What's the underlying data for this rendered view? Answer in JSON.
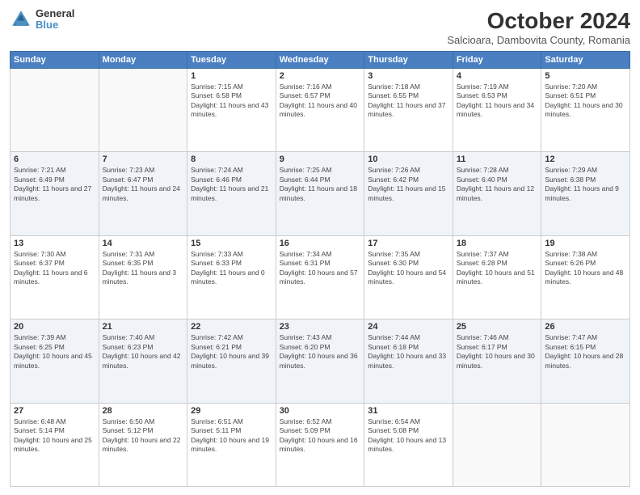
{
  "header": {
    "logo_general": "General",
    "logo_blue": "Blue",
    "main_title": "October 2024",
    "sub_title": "Salcioara, Dambovita County, Romania"
  },
  "days_of_week": [
    "Sunday",
    "Monday",
    "Tuesday",
    "Wednesday",
    "Thursday",
    "Friday",
    "Saturday"
  ],
  "weeks": [
    [
      {
        "day": "",
        "info": ""
      },
      {
        "day": "",
        "info": ""
      },
      {
        "day": "1",
        "info": "Sunrise: 7:15 AM\nSunset: 6:58 PM\nDaylight: 11 hours and 43 minutes."
      },
      {
        "day": "2",
        "info": "Sunrise: 7:16 AM\nSunset: 6:57 PM\nDaylight: 11 hours and 40 minutes."
      },
      {
        "day": "3",
        "info": "Sunrise: 7:18 AM\nSunset: 6:55 PM\nDaylight: 11 hours and 37 minutes."
      },
      {
        "day": "4",
        "info": "Sunrise: 7:19 AM\nSunset: 6:53 PM\nDaylight: 11 hours and 34 minutes."
      },
      {
        "day": "5",
        "info": "Sunrise: 7:20 AM\nSunset: 6:51 PM\nDaylight: 11 hours and 30 minutes."
      }
    ],
    [
      {
        "day": "6",
        "info": "Sunrise: 7:21 AM\nSunset: 6:49 PM\nDaylight: 11 hours and 27 minutes."
      },
      {
        "day": "7",
        "info": "Sunrise: 7:23 AM\nSunset: 6:47 PM\nDaylight: 11 hours and 24 minutes."
      },
      {
        "day": "8",
        "info": "Sunrise: 7:24 AM\nSunset: 6:46 PM\nDaylight: 11 hours and 21 minutes."
      },
      {
        "day": "9",
        "info": "Sunrise: 7:25 AM\nSunset: 6:44 PM\nDaylight: 11 hours and 18 minutes."
      },
      {
        "day": "10",
        "info": "Sunrise: 7:26 AM\nSunset: 6:42 PM\nDaylight: 11 hours and 15 minutes."
      },
      {
        "day": "11",
        "info": "Sunrise: 7:28 AM\nSunset: 6:40 PM\nDaylight: 11 hours and 12 minutes."
      },
      {
        "day": "12",
        "info": "Sunrise: 7:29 AM\nSunset: 6:38 PM\nDaylight: 11 hours and 9 minutes."
      }
    ],
    [
      {
        "day": "13",
        "info": "Sunrise: 7:30 AM\nSunset: 6:37 PM\nDaylight: 11 hours and 6 minutes."
      },
      {
        "day": "14",
        "info": "Sunrise: 7:31 AM\nSunset: 6:35 PM\nDaylight: 11 hours and 3 minutes."
      },
      {
        "day": "15",
        "info": "Sunrise: 7:33 AM\nSunset: 6:33 PM\nDaylight: 11 hours and 0 minutes."
      },
      {
        "day": "16",
        "info": "Sunrise: 7:34 AM\nSunset: 6:31 PM\nDaylight: 10 hours and 57 minutes."
      },
      {
        "day": "17",
        "info": "Sunrise: 7:35 AM\nSunset: 6:30 PM\nDaylight: 10 hours and 54 minutes."
      },
      {
        "day": "18",
        "info": "Sunrise: 7:37 AM\nSunset: 6:28 PM\nDaylight: 10 hours and 51 minutes."
      },
      {
        "day": "19",
        "info": "Sunrise: 7:38 AM\nSunset: 6:26 PM\nDaylight: 10 hours and 48 minutes."
      }
    ],
    [
      {
        "day": "20",
        "info": "Sunrise: 7:39 AM\nSunset: 6:25 PM\nDaylight: 10 hours and 45 minutes."
      },
      {
        "day": "21",
        "info": "Sunrise: 7:40 AM\nSunset: 6:23 PM\nDaylight: 10 hours and 42 minutes."
      },
      {
        "day": "22",
        "info": "Sunrise: 7:42 AM\nSunset: 6:21 PM\nDaylight: 10 hours and 39 minutes."
      },
      {
        "day": "23",
        "info": "Sunrise: 7:43 AM\nSunset: 6:20 PM\nDaylight: 10 hours and 36 minutes."
      },
      {
        "day": "24",
        "info": "Sunrise: 7:44 AM\nSunset: 6:18 PM\nDaylight: 10 hours and 33 minutes."
      },
      {
        "day": "25",
        "info": "Sunrise: 7:46 AM\nSunset: 6:17 PM\nDaylight: 10 hours and 30 minutes."
      },
      {
        "day": "26",
        "info": "Sunrise: 7:47 AM\nSunset: 6:15 PM\nDaylight: 10 hours and 28 minutes."
      }
    ],
    [
      {
        "day": "27",
        "info": "Sunrise: 6:48 AM\nSunset: 5:14 PM\nDaylight: 10 hours and 25 minutes."
      },
      {
        "day": "28",
        "info": "Sunrise: 6:50 AM\nSunset: 5:12 PM\nDaylight: 10 hours and 22 minutes."
      },
      {
        "day": "29",
        "info": "Sunrise: 6:51 AM\nSunset: 5:11 PM\nDaylight: 10 hours and 19 minutes."
      },
      {
        "day": "30",
        "info": "Sunrise: 6:52 AM\nSunset: 5:09 PM\nDaylight: 10 hours and 16 minutes."
      },
      {
        "day": "31",
        "info": "Sunrise: 6:54 AM\nSunset: 5:08 PM\nDaylight: 10 hours and 13 minutes."
      },
      {
        "day": "",
        "info": ""
      },
      {
        "day": "",
        "info": ""
      }
    ]
  ]
}
